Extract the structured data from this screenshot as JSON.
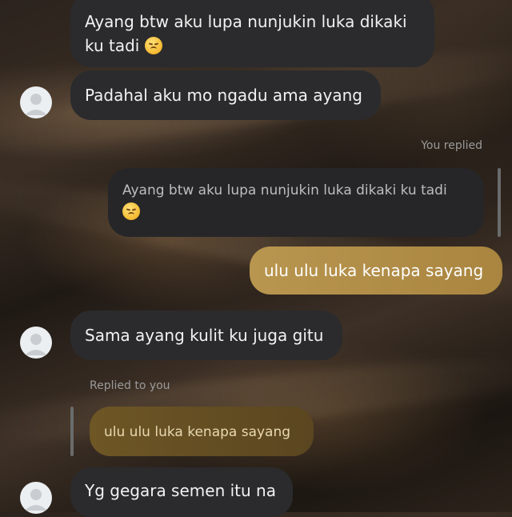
{
  "messages": [
    {
      "text": "Ayang btw aku lupa nunjukin luka dikaki",
      "text2": "ku tadi"
    },
    {
      "text": "Padahal aku mo ngadu ama ayang"
    }
  ],
  "you_replied_label": "You replied",
  "quoted_message": {
    "text": "Ayang btw aku lupa nunjukin luka dikaki ku tadi"
  },
  "sent_message": {
    "text": "ulu ulu luka kenapa sayang"
  },
  "received_2": {
    "text": "Sama ayang kulit ku juga gitu"
  },
  "replied_to_you_label": "Replied to you",
  "quoted_reply": {
    "text": "ulu ulu luka kenapa sayang"
  },
  "received_3": {
    "text": "Yg gegara semen itu na"
  },
  "colors": {
    "sent_bubble": "#b9964f",
    "received_bubble": "#2b2b2d"
  },
  "emoji": "disappointed-face"
}
